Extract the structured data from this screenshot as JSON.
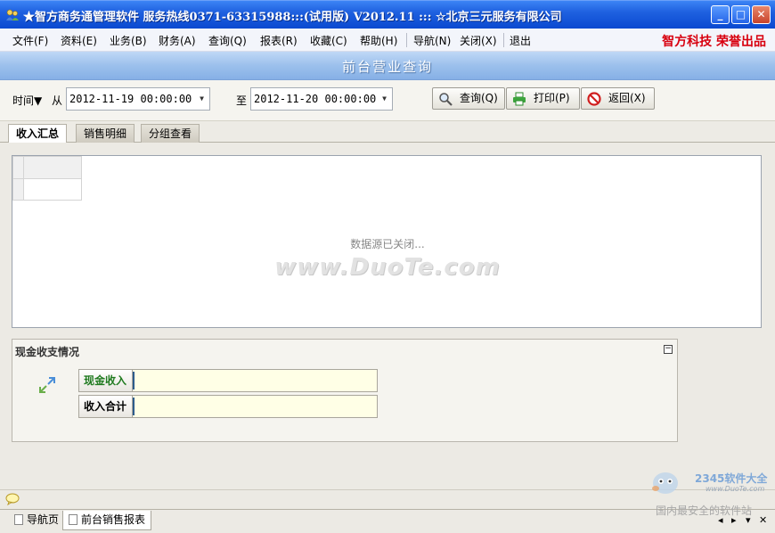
{
  "titlebar": {
    "title": "★智方商务通管理软件  服务热线0371-63315988:::(试用版) V2012.11  :::  ☆北京三元服务有限公司",
    "minimize": "_",
    "maximize": "□",
    "close": "✕"
  },
  "menu": {
    "items": [
      "文件(F)",
      "资料(E)",
      "业务(B)",
      "财务(A)",
      "查询(Q)",
      "报表(R)",
      "收藏(C)",
      "帮助(H)",
      "导航(N)",
      "关闭(X)",
      "退出"
    ],
    "brand": "智方科技  荣誉出品"
  },
  "banner": {
    "title": "前台营业查询"
  },
  "filter": {
    "time_label": "时间▼",
    "from_label": "从",
    "from_value": "2012-11-19 00:00:00",
    "to_label": "至",
    "to_value": "2012-11-20 00:00:00",
    "dropdown_arrow": "▼",
    "query_button": "查询(Q)",
    "print_button": "打印(P)",
    "back_button": "返回(X)"
  },
  "tabs": [
    "收入汇总",
    "销售明细",
    "分组查看"
  ],
  "grid": {
    "status_text": "数据源已关闭...",
    "watermark": "www.DuoTe.com"
  },
  "cash": {
    "title": "现金收支情况",
    "collapse": "−",
    "fields": [
      {
        "label": "现金收入",
        "value": ""
      },
      {
        "label": "收入合计",
        "value": ""
      }
    ]
  },
  "bottom_tabs": [
    "导航页",
    "前台销售报表"
  ],
  "nav_controls": [
    "◂",
    "▸",
    "▾",
    "✕"
  ],
  "corner_watermark": {
    "logo": "2345软件大全",
    "url": "www.DuoTe.com",
    "slogan": "国内最安全的软件站"
  },
  "colors": {
    "title_blue": "#1F61E0",
    "brand_red": "#D8000F",
    "field_yellow": "#FFFFE6"
  }
}
